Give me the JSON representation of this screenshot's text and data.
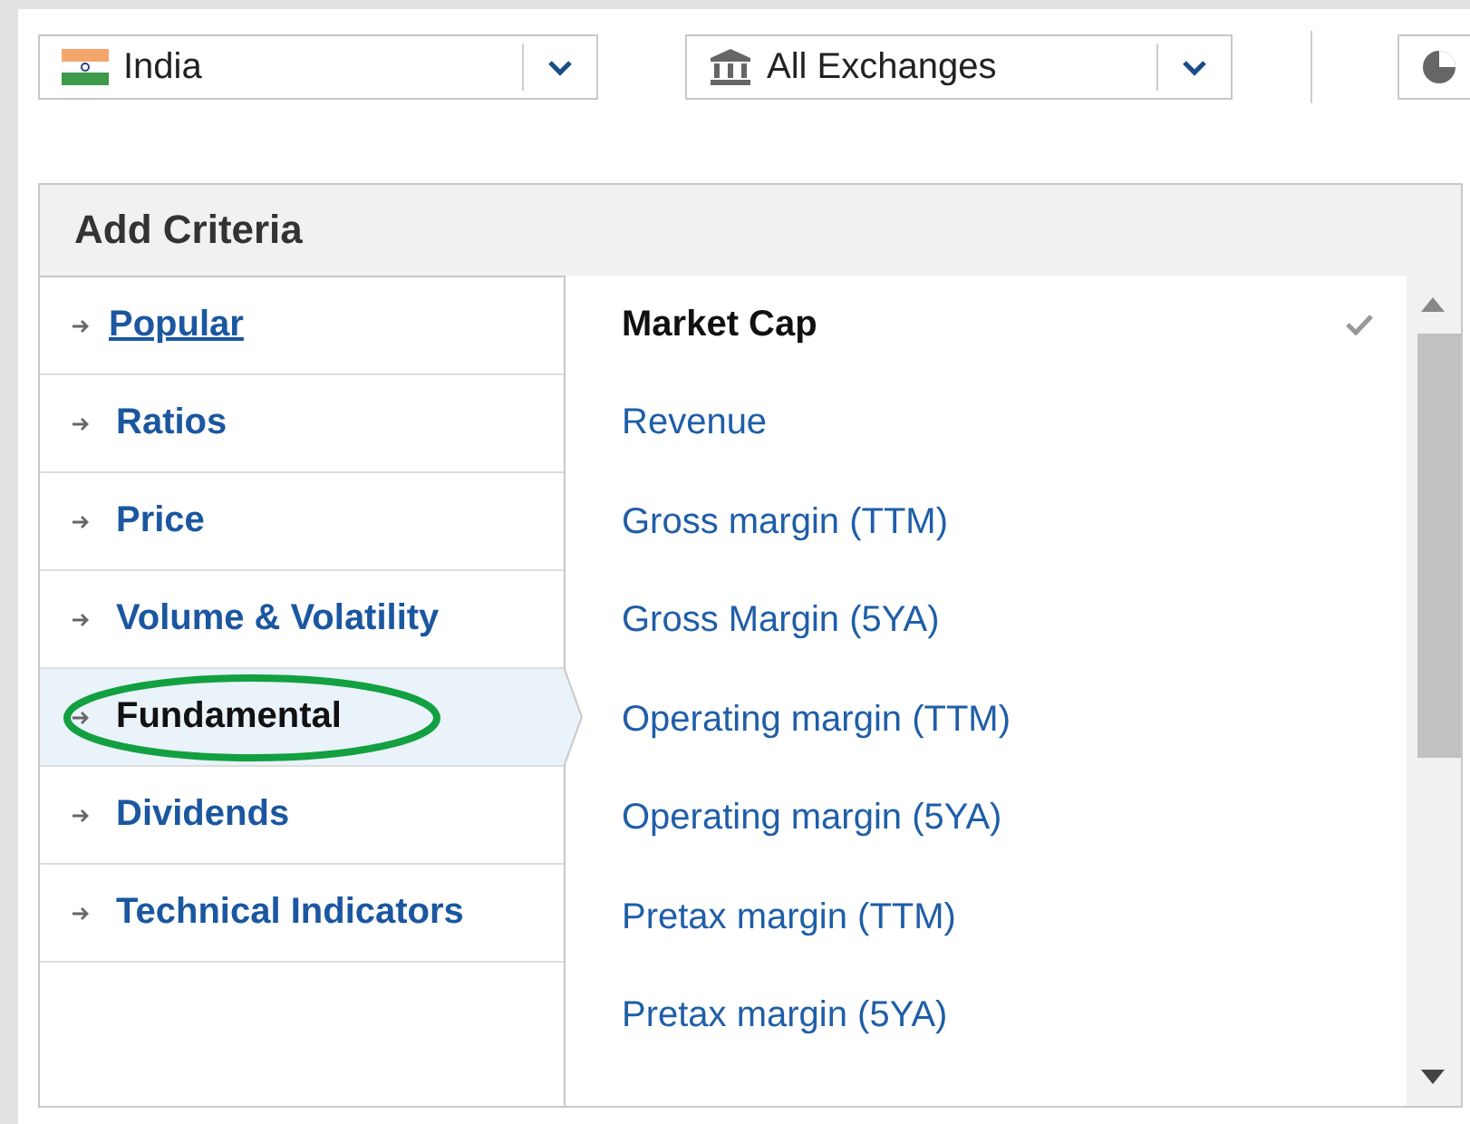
{
  "filters": [
    {
      "kind": "country",
      "value": "India"
    },
    {
      "kind": "exchange",
      "value": "All Exchanges"
    }
  ],
  "panel": {
    "title": "Add Criteria",
    "categories": [
      {
        "label": "Popular",
        "selected": false,
        "underlined": true,
        "highlighted": false
      },
      {
        "label": "Ratios",
        "selected": false,
        "underlined": false,
        "highlighted": false
      },
      {
        "label": "Price",
        "selected": false,
        "underlined": false,
        "highlighted": false
      },
      {
        "label": "Volume & Volatility",
        "selected": false,
        "underlined": false,
        "highlighted": false
      },
      {
        "label": "Fundamental",
        "selected": true,
        "underlined": false,
        "highlighted": true
      },
      {
        "label": "Dividends",
        "selected": false,
        "underlined": false,
        "highlighted": false
      },
      {
        "label": "Technical Indicators",
        "selected": false,
        "underlined": false,
        "highlighted": false
      }
    ],
    "criteria": [
      {
        "label": "Market Cap",
        "checked": true
      },
      {
        "label": "Revenue",
        "checked": false
      },
      {
        "label": "Gross margin (TTM)",
        "checked": false
      },
      {
        "label": "Gross Margin (5YA)",
        "checked": false
      },
      {
        "label": "Operating margin (TTM)",
        "checked": false
      },
      {
        "label": "Operating margin (5YA)",
        "checked": false
      },
      {
        "label": "Pretax margin (TTM)",
        "checked": false
      },
      {
        "label": "Pretax margin (5YA)",
        "checked": false
      }
    ]
  }
}
